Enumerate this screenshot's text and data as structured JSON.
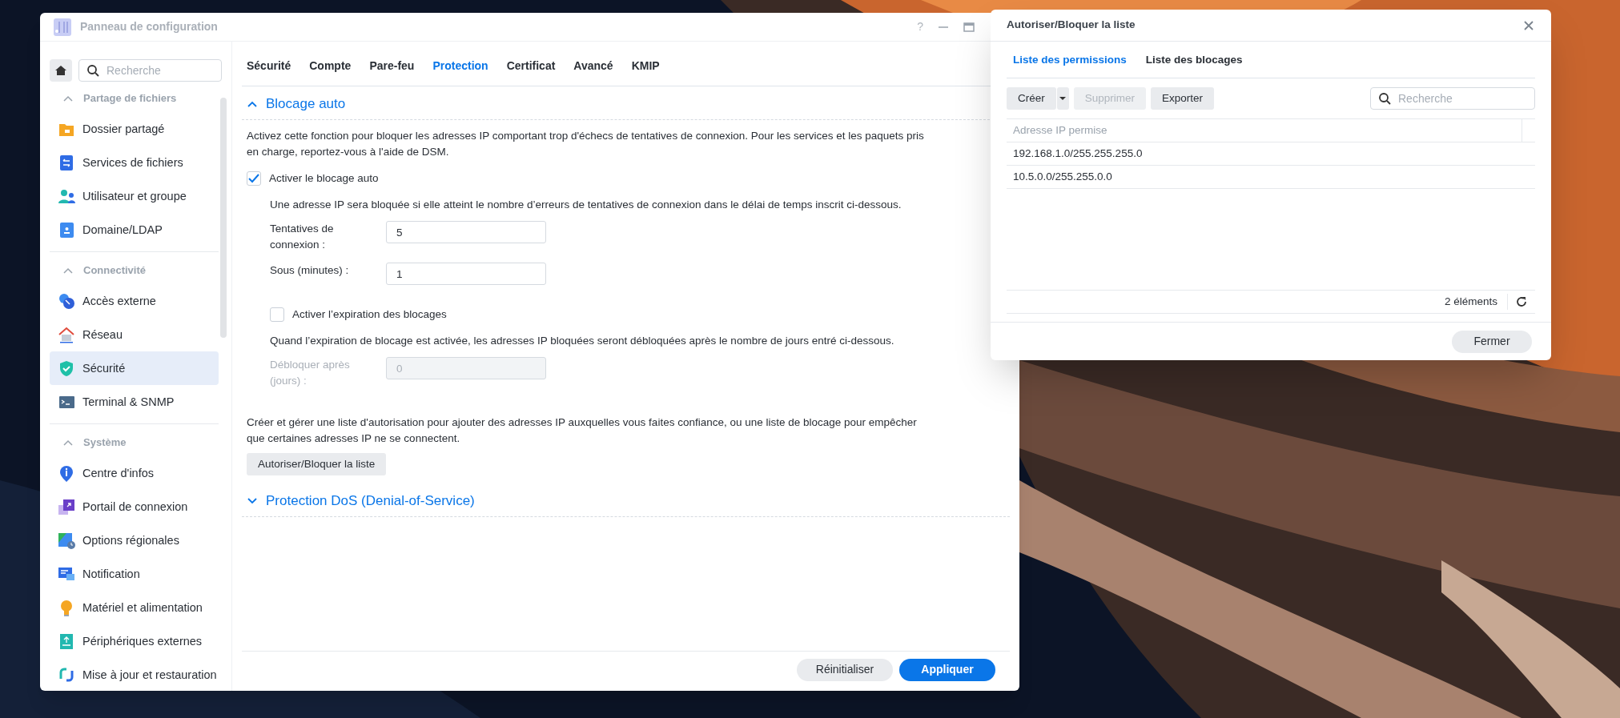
{
  "window": {
    "title": "Panneau de configuration",
    "title_buttons": [
      "?"
    ]
  },
  "sidebar": {
    "search": {
      "placeholder": "Recherche"
    },
    "groups": [
      {
        "label": "Partage de fichiers",
        "expanded": true,
        "items": [
          {
            "label": "Dossier partagé",
            "kind": "folder",
            "selected": false
          },
          {
            "label": "Services de fichiers",
            "kind": "fileservice",
            "selected": false
          },
          {
            "label": "Utilisateur et groupe",
            "kind": "users",
            "selected": false
          },
          {
            "label": "Domaine/LDAP",
            "kind": "domain",
            "selected": false
          }
        ]
      },
      {
        "label": "Connectivité",
        "expanded": true,
        "items": [
          {
            "label": "Accès externe",
            "kind": "external",
            "selected": false
          },
          {
            "label": "Réseau",
            "kind": "network",
            "selected": false
          },
          {
            "label": "Sécurité",
            "kind": "security",
            "selected": true
          },
          {
            "label": "Terminal & SNMP",
            "kind": "terminal",
            "selected": false
          }
        ]
      },
      {
        "label": "Système",
        "expanded": true,
        "items": [
          {
            "label": "Centre d'infos",
            "kind": "info",
            "selected": false
          },
          {
            "label": "Portail de connexion",
            "kind": "portal",
            "selected": false
          },
          {
            "label": "Options régionales",
            "kind": "regional",
            "selected": false
          },
          {
            "label": "Notification",
            "kind": "notification",
            "selected": false
          },
          {
            "label": "Matériel et alimentation",
            "kind": "hardware",
            "selected": false
          },
          {
            "label": "Périphériques externes",
            "kind": "devices",
            "selected": false
          },
          {
            "label": "Mise à jour et restauration",
            "kind": "update",
            "selected": false
          }
        ]
      }
    ]
  },
  "tabs": [
    {
      "label": "Sécurité",
      "selected": false
    },
    {
      "label": "Compte",
      "selected": false
    },
    {
      "label": "Pare-feu",
      "selected": false
    },
    {
      "label": "Protection",
      "selected": true
    },
    {
      "label": "Certificat",
      "selected": false
    },
    {
      "label": "Avancé",
      "selected": false
    },
    {
      "label": "KMIP",
      "selected": false
    }
  ],
  "sections": [
    {
      "title": "Blocage auto",
      "expanded": true,
      "description": "Activez cette fonction pour bloquer les adresses IP comportant trop d'échecs de tentatives de connexion. Pour les services et les paquets pris\nen charge, reportez-vous à l'aide de DSM.",
      "rows": [
        {
          "kind": "checkbox",
          "label": "Activer le blocage auto",
          "checked": true
        },
        {
          "kind": "note",
          "text": "Une adresse IP sera bloquée si elle atteint le nombre d’erreurs de tentatives de connexion dans le délai de temps inscrit ci-dessous."
        },
        {
          "kind": "field",
          "label": "Tentatives de connexion :",
          "value": "5",
          "disabled": false
        },
        {
          "kind": "field",
          "label": "Sous (minutes) :",
          "value": "1",
          "disabled": false
        },
        {
          "kind": "checkbox",
          "label": "Activer l’expiration des blocages",
          "checked": false
        },
        {
          "kind": "note",
          "text": "Quand l’expiration de blocage est activée, les adresses IP bloquées seront débloquées après le nombre de jours entré ci-dessous."
        },
        {
          "kind": "field",
          "label": "Débloquer après (jours) :",
          "value": "0",
          "disabled": true
        }
      ],
      "list_text": "Créer et gérer une liste d'autorisation pour ajouter des adresses IP auxquelles vous faites confiance, ou une liste de blocage pour empêcher\nque certaines adresses IP ne se connectent.",
      "list_button": "Autoriser/Bloquer la liste"
    },
    {
      "title": "Protection DoS (Denial-of-Service)",
      "expanded": false
    }
  ],
  "footer_buttons": [
    {
      "label": "Réinitialiser",
      "kind": "secondary"
    },
    {
      "label": "Appliquer",
      "kind": "primary"
    }
  ],
  "dialog": {
    "title": "Autoriser/Bloquer la liste",
    "tabs": [
      {
        "label": "Liste des permissions",
        "selected": true
      },
      {
        "label": "Liste des blocages",
        "selected": false
      }
    ],
    "toolbar": [
      {
        "label": "Créer",
        "kind": "split",
        "disabled": false
      },
      {
        "label": "Supprimer",
        "kind": "plain",
        "disabled": true
      },
      {
        "label": "Exporter",
        "kind": "plain",
        "disabled": false
      }
    ],
    "search": {
      "placeholder": "Recherche"
    },
    "columns": [
      "Adresse IP permise"
    ],
    "rows": [
      [
        "192.168.1.0/255.255.255.0"
      ],
      [
        "10.5.0.0/255.255.0.0"
      ]
    ],
    "count": "2 éléments",
    "close_button": "Fermer"
  }
}
